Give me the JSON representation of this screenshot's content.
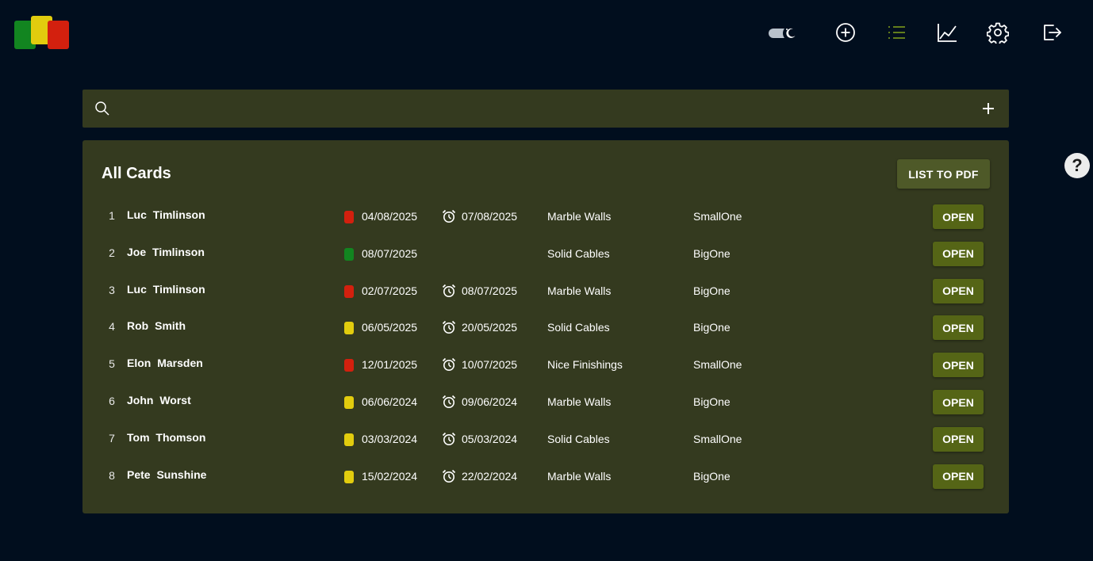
{
  "header": {
    "logo_name": "app-logo",
    "icons": [
      "theme-toggle",
      "add-circle-icon",
      "list-icon",
      "chart-icon",
      "gear-icon",
      "logout-icon"
    ],
    "active_color": "#6d8a1c"
  },
  "search": {
    "placeholder": "",
    "value": ""
  },
  "panel": {
    "title": "All Cards",
    "pdf_label": "LIST TO PDF"
  },
  "colors": {
    "red": "#d3200e",
    "green": "#128520",
    "yellow": "#e2cc0e"
  },
  "rows": [
    {
      "num": "1",
      "name": "Luc  Timlinson",
      "status": "red",
      "date": "04/08/2025",
      "has_deadline": true,
      "deadline": "07/08/2025",
      "project": "Marble Walls",
      "size": "SmallOne",
      "action": "OPEN"
    },
    {
      "num": "2",
      "name": "Joe  Timlinson",
      "status": "green",
      "date": "08/07/2025",
      "has_deadline": false,
      "deadline": "",
      "project": "Solid Cables",
      "size": "BigOne",
      "action": "OPEN"
    },
    {
      "num": "3",
      "name": "Luc  Timlinson",
      "status": "red",
      "date": "02/07/2025",
      "has_deadline": true,
      "deadline": "08/07/2025",
      "project": "Marble Walls",
      "size": "BigOne",
      "action": "OPEN"
    },
    {
      "num": "4",
      "name": "Rob  Smith",
      "status": "yellow",
      "date": "06/05/2025",
      "has_deadline": true,
      "deadline": "20/05/2025",
      "project": "Solid Cables",
      "size": "BigOne",
      "action": "OPEN"
    },
    {
      "num": "5",
      "name": "Elon  Marsden",
      "status": "red",
      "date": "12/01/2025",
      "has_deadline": true,
      "deadline": "10/07/2025",
      "project": "Nice Finishings",
      "size": "SmallOne",
      "action": "OPEN"
    },
    {
      "num": "6",
      "name": "John  Worst",
      "status": "yellow",
      "date": "06/06/2024",
      "has_deadline": true,
      "deadline": "09/06/2024",
      "project": "Marble Walls",
      "size": "BigOne",
      "action": "OPEN"
    },
    {
      "num": "7",
      "name": "Tom  Thomson",
      "status": "yellow",
      "date": "03/03/2024",
      "has_deadline": true,
      "deadline": "05/03/2024",
      "project": "Solid Cables",
      "size": "SmallOne",
      "action": "OPEN"
    },
    {
      "num": "8",
      "name": "Pete  Sunshine",
      "status": "yellow",
      "date": "15/02/2024",
      "has_deadline": true,
      "deadline": "22/02/2024",
      "project": "Marble Walls",
      "size": "BigOne",
      "action": "OPEN"
    }
  ],
  "help": {
    "label": "?"
  }
}
